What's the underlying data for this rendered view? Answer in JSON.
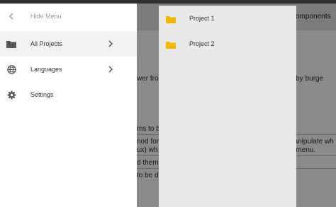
{
  "colors": {
    "folder": "#f5b800",
    "menu_bg": "#ffffff",
    "submenu_bg": "#e9e9e9",
    "overlay": "#7a7a7a"
  },
  "menu": {
    "hide_label": "Hide Menu",
    "items": [
      {
        "label": "All Projects",
        "icon": "folder-icon",
        "has_submenu": true
      },
      {
        "label": "Languages",
        "icon": "globe-icon",
        "has_submenu": true
      },
      {
        "label": "Settings",
        "icon": "gear-icon",
        "has_submenu": false
      }
    ]
  },
  "submenu": {
    "items": [
      {
        "label": "Project 1",
        "icon": "folder-icon"
      },
      {
        "label": "Project 2",
        "icon": "folder-icon"
      }
    ]
  },
  "background": {
    "nav_fragment": "omponents",
    "fragments": [
      "wer fro",
      "red by burge",
      "ms to b",
      "nod for",
      "nanipulate wh",
      "ux) wh",
      "e menu.",
      "d theme",
      "to be d"
    ]
  }
}
